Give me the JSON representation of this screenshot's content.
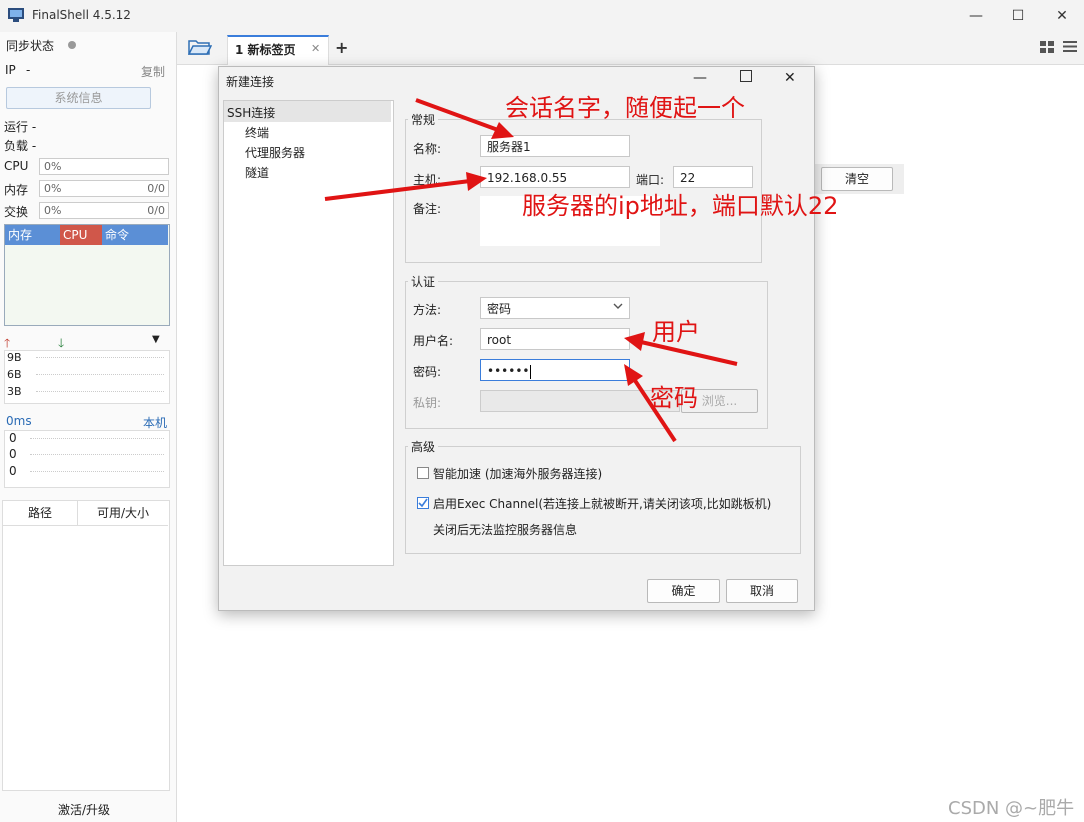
{
  "window": {
    "title": "FinalShell 4.5.12",
    "min": "—",
    "max": "☐",
    "close": "✕"
  },
  "left": {
    "sync_label": "同步状态",
    "ip_label": "IP",
    "ip_value": "-",
    "copy_label": "复制",
    "sysinfo_button": "系统信息",
    "uptime": "运行 -",
    "load": "负载 -",
    "cpu_label": "CPU",
    "cpu_value": "0%",
    "mem_label": "内存",
    "mem_value": "0%",
    "mem_ratio": "0/0",
    "swap_label": "交换",
    "swap_value": "0%",
    "swap_ratio": "0/0",
    "proc_headers": [
      "内存",
      "CPU",
      "命令"
    ],
    "net_ticks": [
      "9B",
      "6B",
      "3B"
    ],
    "ping_label": "0ms",
    "ping_host": "本机",
    "ping_ticks": [
      "0",
      "0",
      "0"
    ],
    "disk_headers": [
      "路径",
      "可用/大小"
    ],
    "activate": "激活/升级"
  },
  "tabs": {
    "tab1_label": "1 新标签页",
    "add": "+"
  },
  "background": {
    "clear_button": "清空"
  },
  "dialog": {
    "title": "新建连接",
    "tree": [
      "SSH连接",
      "终端",
      "代理服务器",
      "隧道"
    ],
    "general_legend": "常规",
    "name_label": "名称:",
    "name_value": "服务器1",
    "host_label": "主机:",
    "host_value": "192.168.0.55",
    "port_label": "端口:",
    "port_value": "22",
    "note_label": "备注:",
    "auth_legend": "认证",
    "method_label": "方法:",
    "method_value": "密码",
    "user_label": "用户名:",
    "user_value": "root",
    "password_label": "密码:",
    "password_value": "••••••",
    "key_label": "私钥:",
    "browse_button": "浏览...",
    "advanced_legend": "高级",
    "accel_label": "智能加速 (加速海外服务器连接)",
    "accel_checked": false,
    "exec_label": "启用Exec Channel(若连接上就被断开,请关闭该项,比如跳板机)",
    "exec_checked": true,
    "exec_note": "关闭后无法监控服务器信息",
    "ok_button": "确定",
    "cancel_button": "取消"
  },
  "annotations": {
    "session_name": "会话名字，随便起一个",
    "server_ip": "服务器的ip地址，端口默认22",
    "user": "用户",
    "password": "密码",
    "arrow_color": "#e01414"
  },
  "watermark": "CSDN @~肥牛"
}
